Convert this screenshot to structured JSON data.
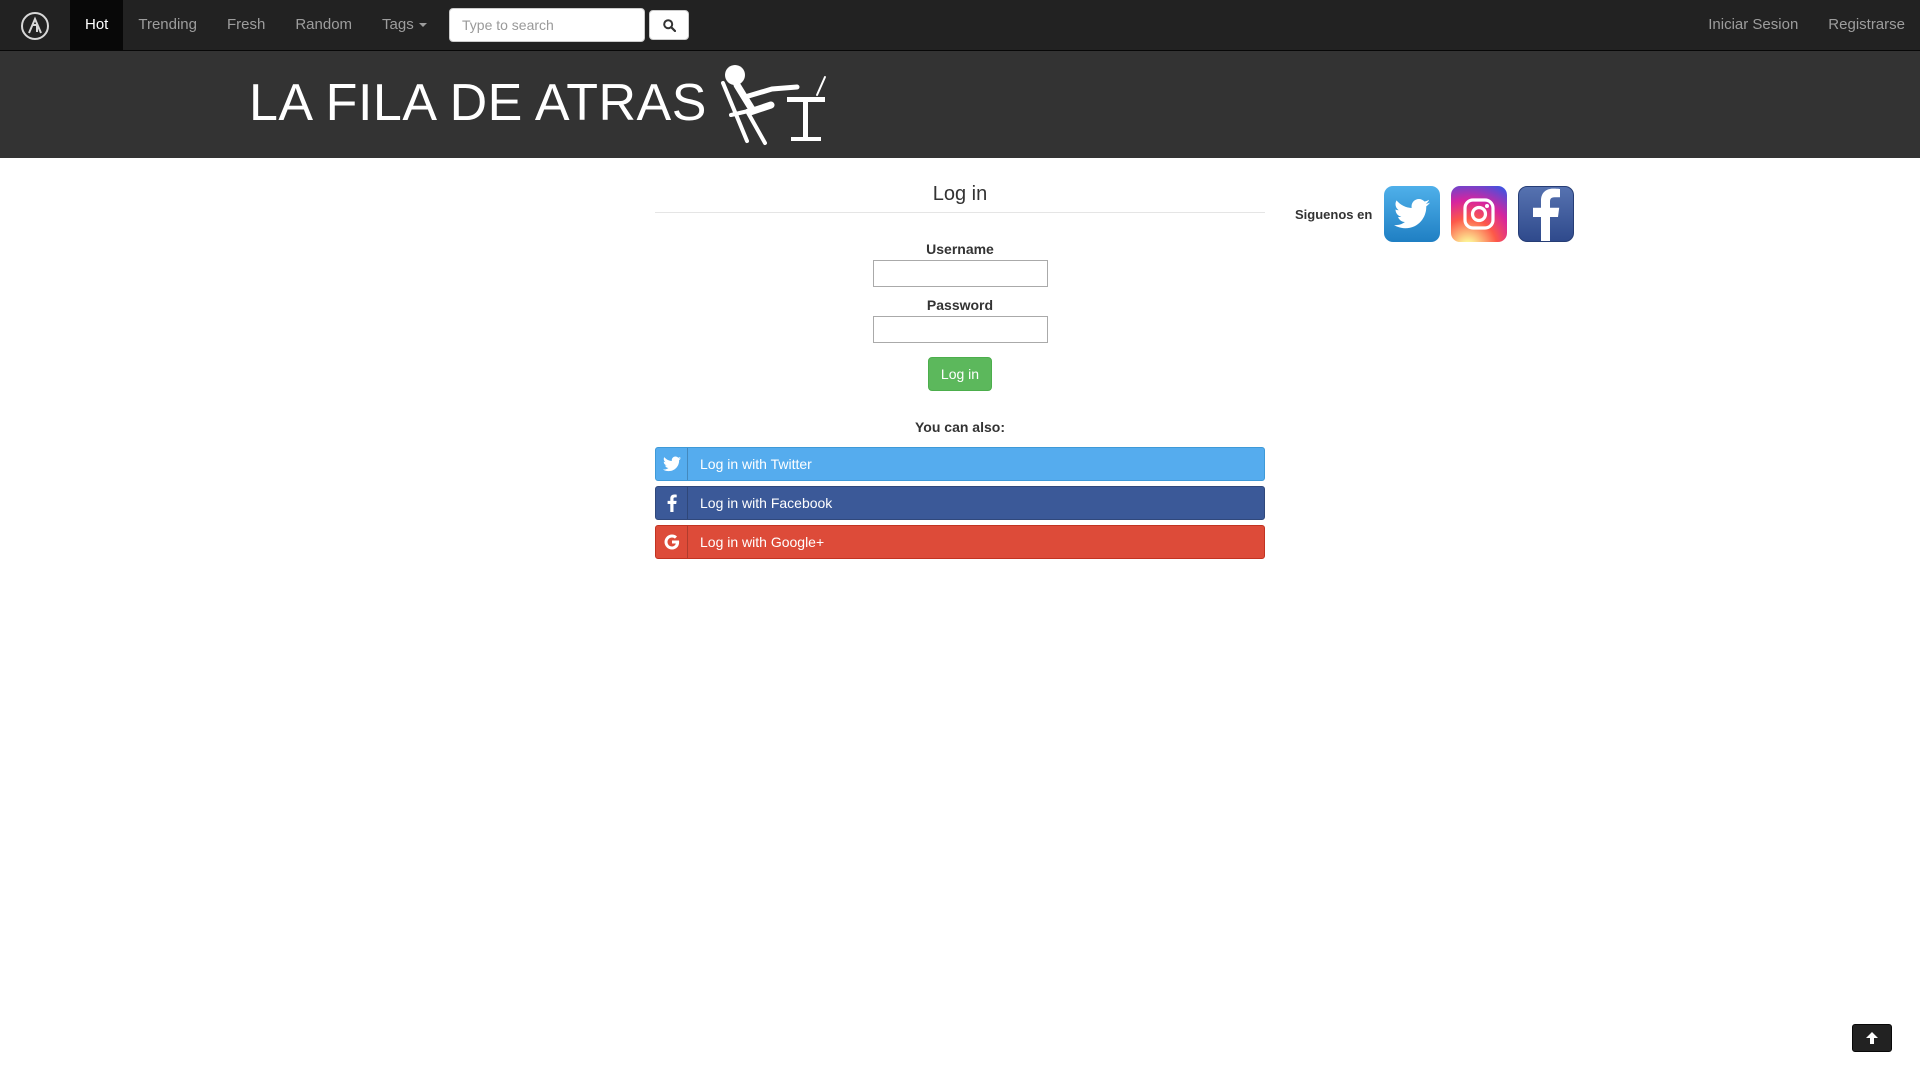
{
  "navbar": {
    "brand_icon": "site-logo-icon",
    "items": [
      {
        "label": "Hot",
        "active": true
      },
      {
        "label": "Trending",
        "active": false
      },
      {
        "label": "Fresh",
        "active": false
      },
      {
        "label": "Random",
        "active": false
      },
      {
        "label": "Tags",
        "active": false
      }
    ],
    "search": {
      "placeholder": "Type to search",
      "value": ""
    },
    "right": {
      "login": "Iniciar Sesion",
      "register": "Registrarse"
    }
  },
  "banner": {
    "title": "LA FILA DE ATRAS",
    "logo_icon": "student-at-desk-icon"
  },
  "login": {
    "title": "Log in",
    "username_label": "Username",
    "username_value": "",
    "password_label": "Password",
    "password_value": "",
    "submit_label": "Log in",
    "also_label": "You can also:",
    "twitter_label": "Log in with Twitter",
    "facebook_label": "Log in with Facebook",
    "google_label": "Log in with Google+"
  },
  "follow": {
    "label": "Siguenos en"
  },
  "colors": {
    "navbar_bg": "#222222",
    "banner_bg": "#333333",
    "login_button": "#5cb85c",
    "twitter": "#55acee",
    "facebook": "#3b5998",
    "google": "#dd4b39"
  }
}
